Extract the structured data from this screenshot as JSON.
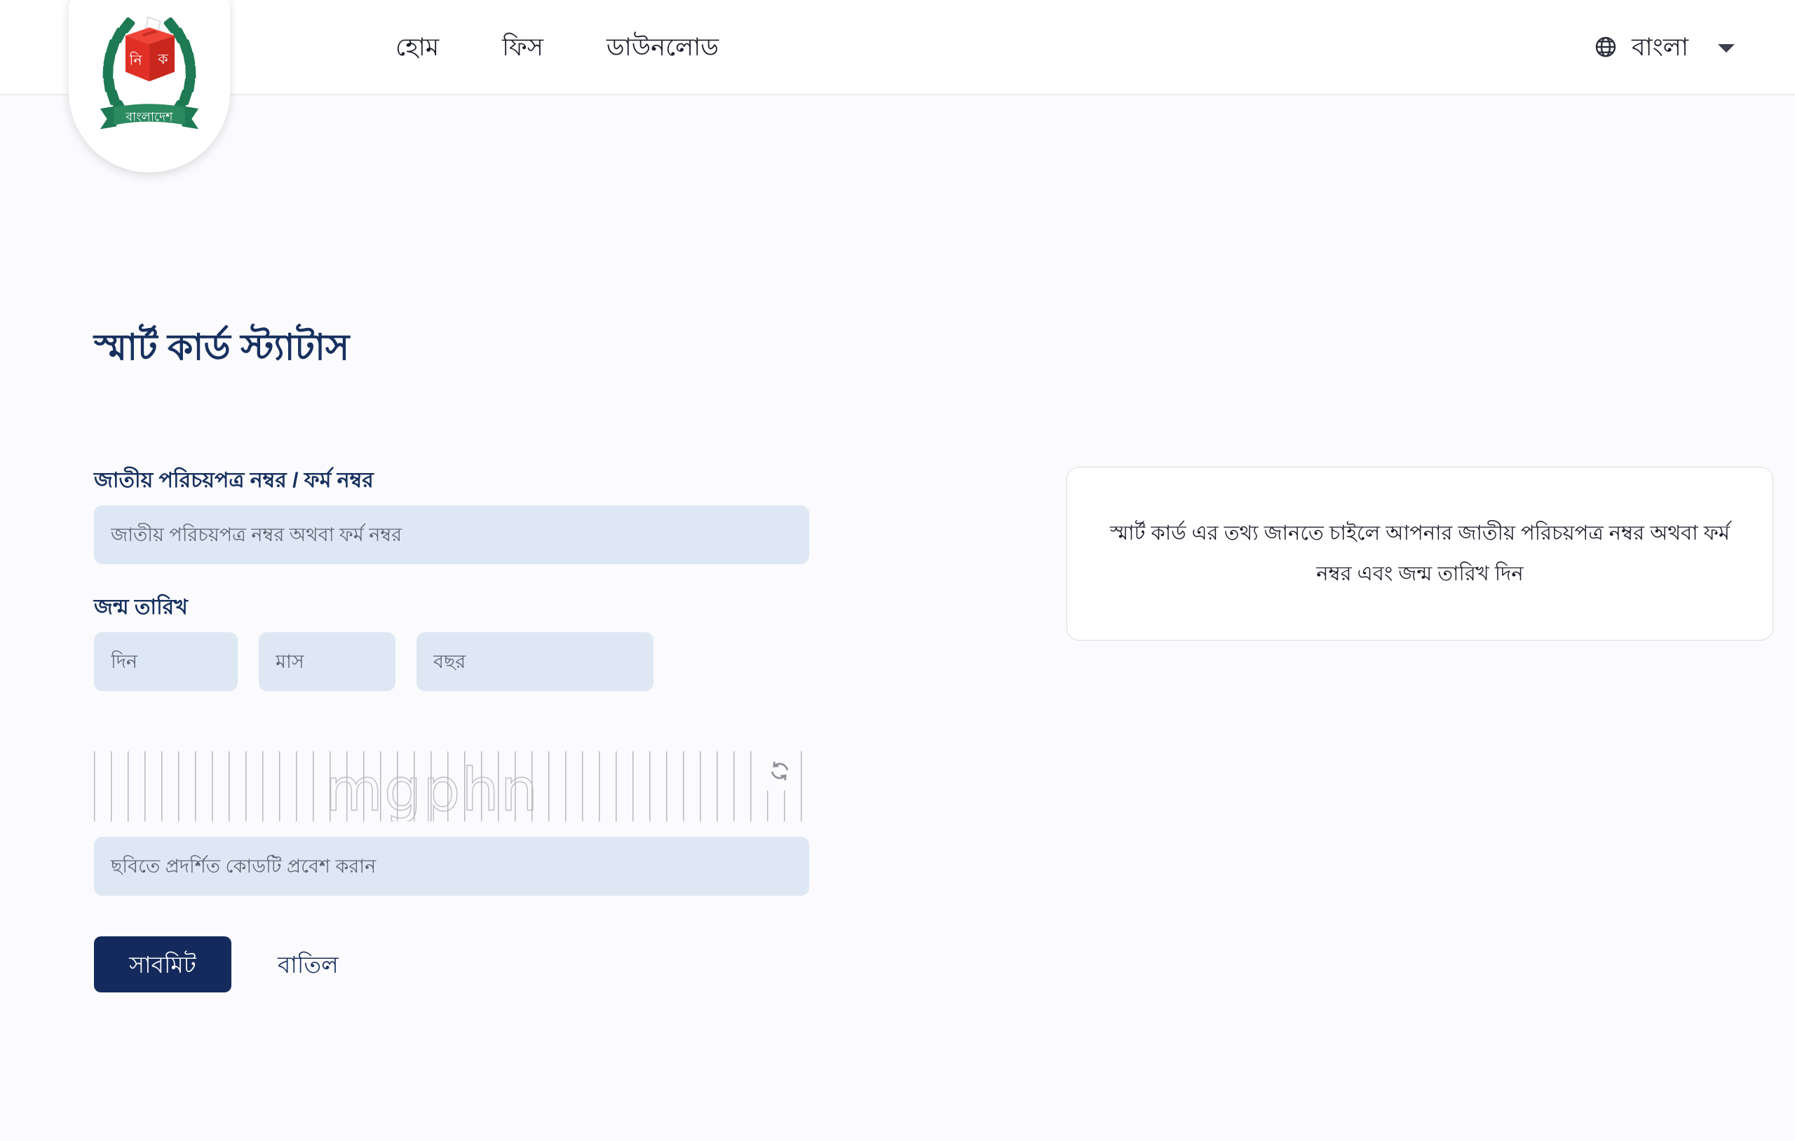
{
  "header": {
    "logo": {
      "name": "bangladesh-election-commission-emblem",
      "box_text_left": "নি",
      "box_text_right": "ক",
      "ribbon_text": "বাংলাদেশ",
      "wreath_color": "#1e7a52",
      "box_color": "#e03025"
    },
    "nav_items": [
      {
        "label": "হোম",
        "name": "nav-item-home"
      },
      {
        "label": "ফিস",
        "name": "nav-item-fees"
      },
      {
        "label": "ডাউনলোড",
        "name": "nav-item-download"
      }
    ],
    "language": {
      "icon": "globe-icon",
      "label": "বাংলা",
      "caret": "chevron-down-icon"
    }
  },
  "main": {
    "page_title": "স্মার্ট কার্ড স্ট্যাটাস",
    "nid_field": {
      "label": "জাতীয় পরিচয়পত্র নম্বর / ফর্ম নম্বর",
      "placeholder": "জাতীয় পরিচয়পত্র নম্বর অথবা ফর্ম নম্বর",
      "value": ""
    },
    "dob": {
      "label": "জন্ম তারিখ",
      "day": {
        "placeholder": "দিন",
        "value": ""
      },
      "month": {
        "placeholder": "মাস",
        "value": ""
      },
      "year": {
        "placeholder": "বছর",
        "value": ""
      }
    },
    "captcha": {
      "code_text": "mgphn",
      "refresh_icon": "refresh-icon",
      "input_placeholder": "ছবিতে প্রদর্শিত কোডটি প্রবেশ করান",
      "input_value": ""
    },
    "buttons": {
      "submit": "সাবমিট",
      "cancel": "বাতিল"
    },
    "info_card": {
      "text": "স্মার্ট কার্ড এর তথ্য জানতে চাইলে আপনার জাতীয় পরিচয়পত্র নম্বর অথবা ফর্ম নম্বর এবং জন্ম তারিখ দিন"
    }
  },
  "colors": {
    "page_background": "#fbfaFD",
    "header_background": "#ffffff",
    "brand_navy": "#17305e",
    "submit_button": "#142a5c",
    "input_background": "#dde8f4",
    "text_dark": "#1b1d2a"
  }
}
